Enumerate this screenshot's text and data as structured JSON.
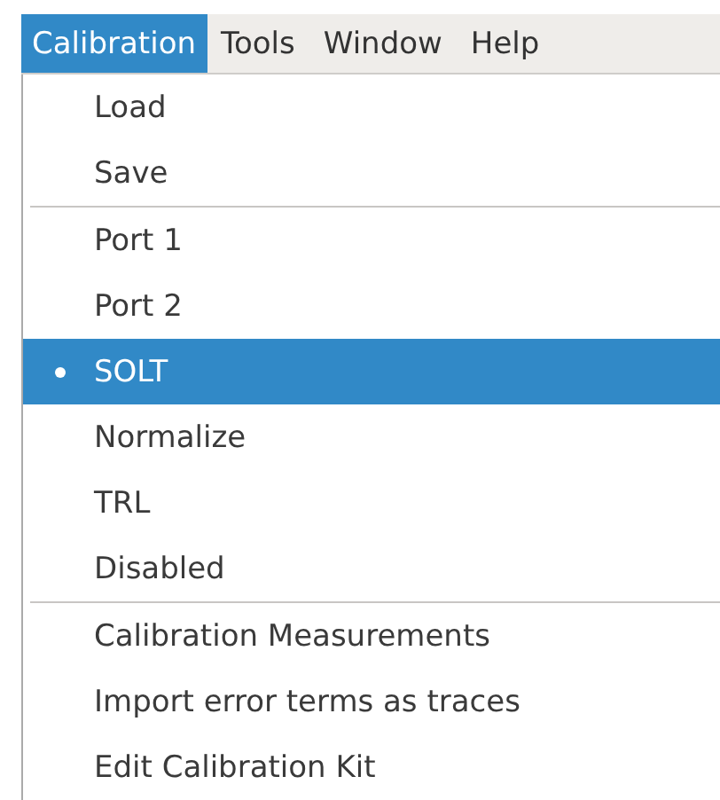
{
  "menubar": [
    {
      "label": "Calibration",
      "selected": true
    },
    {
      "label": "Tools",
      "selected": false
    },
    {
      "label": "Window",
      "selected": false
    },
    {
      "label": "Help",
      "selected": false
    }
  ],
  "menu": {
    "groups": [
      {
        "items": [
          {
            "label": "Load",
            "selected": false
          },
          {
            "label": "Save",
            "selected": false
          }
        ]
      },
      {
        "items": [
          {
            "label": "Port 1",
            "selected": false
          },
          {
            "label": "Port 2",
            "selected": false
          },
          {
            "label": "SOLT",
            "selected": true
          },
          {
            "label": "Normalize",
            "selected": false
          },
          {
            "label": "TRL",
            "selected": false
          },
          {
            "label": "Disabled",
            "selected": false
          }
        ]
      },
      {
        "items": [
          {
            "label": "Calibration Measurements",
            "selected": false
          },
          {
            "label": "Import error terms as traces",
            "selected": false
          },
          {
            "label": "Edit Calibration Kit",
            "selected": false
          }
        ]
      }
    ]
  }
}
